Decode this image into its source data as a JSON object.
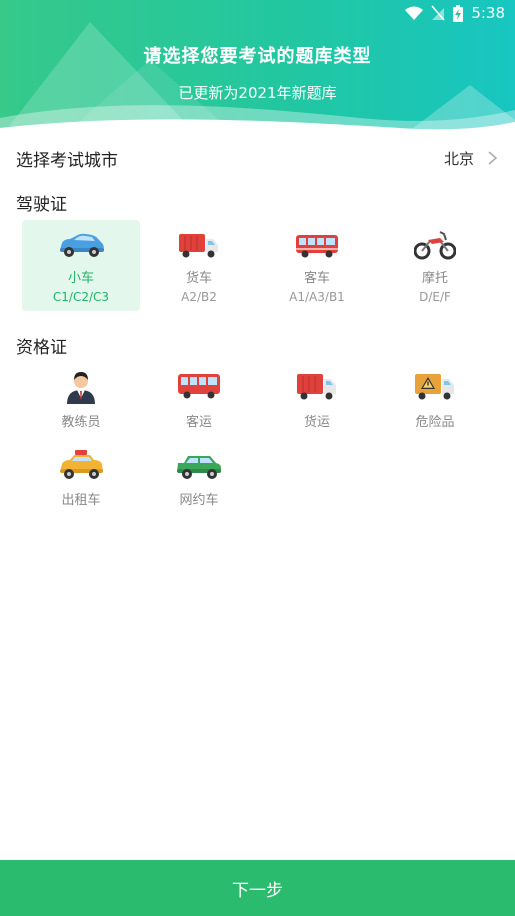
{
  "status_bar": {
    "time": "5:38",
    "icons": [
      "wifi-icon",
      "signal-off-icon",
      "battery-charging-icon"
    ]
  },
  "header": {
    "title": "请选择您要考试的题库类型",
    "subtitle": "已更新为2021年新题库"
  },
  "city": {
    "label": "选择考试城市",
    "value": "北京",
    "icon": "chevron-right-icon"
  },
  "driving": {
    "title": "驾驶证",
    "items": [
      {
        "name": "小车",
        "code": "C1/C2/C3",
        "icon": "car-icon",
        "selected": true
      },
      {
        "name": "货车",
        "code": "A2/B2",
        "icon": "truck-icon",
        "selected": false
      },
      {
        "name": "客车",
        "code": "A1/A3/B1",
        "icon": "bus-icon",
        "selected": false
      },
      {
        "name": "摩托",
        "code": "D/E/F",
        "icon": "motorcycle-icon",
        "selected": false
      }
    ]
  },
  "qualification": {
    "title": "资格证",
    "items": [
      {
        "name": "教练员",
        "icon": "instructor-icon"
      },
      {
        "name": "客运",
        "icon": "passenger-bus-icon"
      },
      {
        "name": "货运",
        "icon": "freight-truck-icon"
      },
      {
        "name": "危险品",
        "icon": "hazmat-truck-icon"
      },
      {
        "name": "出租车",
        "icon": "taxi-icon"
      },
      {
        "name": "网约车",
        "icon": "ride-hailing-car-icon"
      }
    ]
  },
  "next_button": {
    "label": "下一步"
  },
  "colors": {
    "accent": "#2bbb6f",
    "selected_bg": "#e3f7ed",
    "selected_text": "#22b566"
  }
}
